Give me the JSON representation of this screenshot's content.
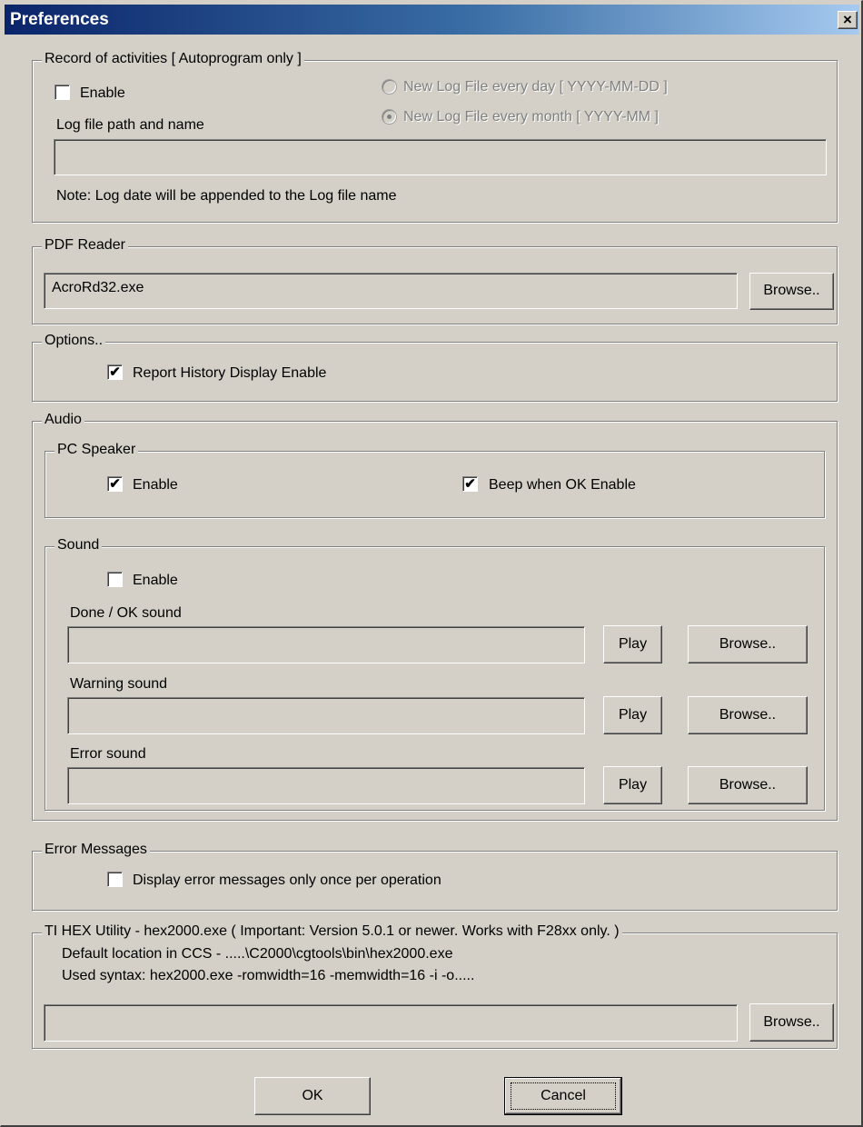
{
  "window": {
    "title": "Preferences",
    "close_glyph": "×"
  },
  "record": {
    "legend": "Record of activities [ Autoprogram only ]",
    "enable_label": "Enable",
    "enable_checked": false,
    "log_path_label": "Log file path and name",
    "radio_day_label": "New Log File every day  [ YYYY-MM-DD ]",
    "radio_month_label": "New Log File every month  [ YYYY-MM ]",
    "radio_selected": "month",
    "log_path_value": "",
    "note": "Note:  Log date will be appended to the Log file name"
  },
  "pdf": {
    "legend": "PDF Reader",
    "path_value": "AcroRd32.exe",
    "browse_label": "Browse.."
  },
  "options": {
    "legend": "Options..",
    "report_history_label": "Report History Display Enable",
    "report_history_checked": true
  },
  "audio": {
    "legend": "Audio",
    "pc_speaker": {
      "legend": "PC Speaker",
      "enable_label": "Enable",
      "enable_checked": true,
      "beep_label": "Beep when OK Enable",
      "beep_checked": true
    },
    "sound": {
      "legend": "Sound",
      "enable_label": "Enable",
      "enable_checked": false,
      "done_label": "Done / OK sound",
      "warning_label": "Warning sound",
      "error_label": "Error sound",
      "play_label": "Play",
      "browse_label": "Browse..",
      "done_value": "",
      "warning_value": "",
      "error_value": ""
    }
  },
  "errors": {
    "legend": "Error Messages",
    "once_label": "Display error messages only once per operation",
    "once_checked": false
  },
  "hex": {
    "legend": "TI HEX Utility - hex2000.exe ( Important: Version 5.0.1 or newer. Works with F28xx only. )",
    "line1": "Default location in CCS - .....\\C2000\\cgtools\\bin\\hex2000.exe",
    "line2": "Used syntax: hex2000.exe  -romwidth=16 -memwidth=16 -i -o.....",
    "path_value": "",
    "browse_label": "Browse.."
  },
  "footer": {
    "ok_label": "OK",
    "cancel_label": "Cancel"
  },
  "icons": {
    "check": "✔",
    "close": "close-icon"
  }
}
